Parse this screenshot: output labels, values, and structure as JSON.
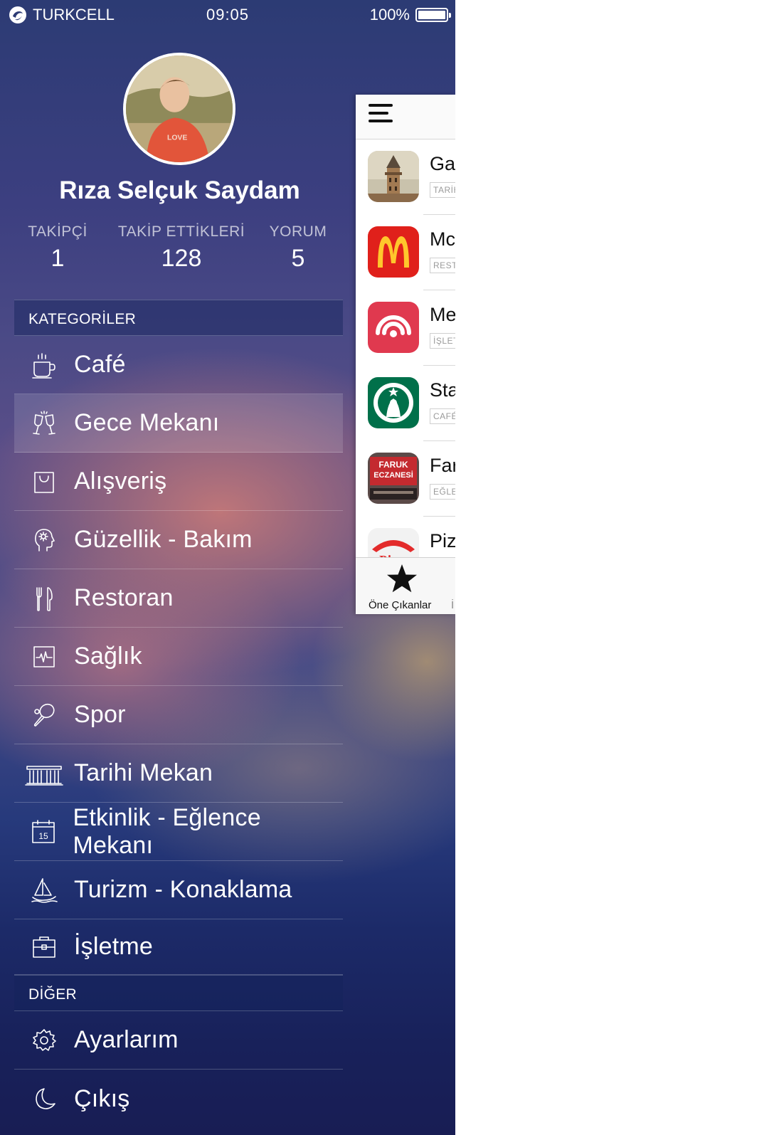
{
  "status_bar": {
    "carrier": "TURKCELL",
    "time": "09:05",
    "battery_text": "100%",
    "battery_level": 1.0
  },
  "profile": {
    "name": "Rıza Selçuk Saydam",
    "stats": [
      {
        "label": "TAKİPÇİ",
        "value": "1"
      },
      {
        "label": "TAKİP ETTİKLERİ",
        "value": "128"
      },
      {
        "label": "YORUM",
        "value": "5"
      }
    ]
  },
  "menu": {
    "categories_header": "KATEGORİLER",
    "categories": [
      {
        "label": "Café",
        "icon": "coffee-cup-icon"
      },
      {
        "label": "Gece Mekanı",
        "icon": "cheers-glasses-icon",
        "active": true
      },
      {
        "label": "Alışveriş",
        "icon": "shopping-bag-icon"
      },
      {
        "label": "Güzellik - Bakım",
        "icon": "beauty-head-icon"
      },
      {
        "label": "Restoran",
        "icon": "fork-knife-icon"
      },
      {
        "label": "Sağlık",
        "icon": "heartbeat-icon"
      },
      {
        "label": "Spor",
        "icon": "racket-icon"
      },
      {
        "label": "Tarihi Mekan",
        "icon": "historic-building-icon"
      },
      {
        "label": "Etkinlik - Eğlence Mekanı",
        "icon": "calendar-icon",
        "calendar_day": "15"
      },
      {
        "label": "Turizm - Konaklama",
        "icon": "sailboat-icon"
      },
      {
        "label": "İşletme",
        "icon": "briefcase-icon"
      }
    ],
    "other_header": "DİĞER",
    "other": [
      {
        "label": "Ayarlarım",
        "icon": "gear-icon"
      },
      {
        "label": "Çıkış",
        "icon": "moon-icon"
      }
    ]
  },
  "feed": {
    "items": [
      {
        "title": "Gal",
        "tag": "TARİH"
      },
      {
        "title": "Mc",
        "tag": "REST"
      },
      {
        "title": "Me",
        "tag": "İŞLET"
      },
      {
        "title": "Sta",
        "tag": "CAFÉ"
      },
      {
        "title": "Far",
        "tag": "EĞLE"
      },
      {
        "title": "Piz",
        "tag": ""
      }
    ],
    "thumb_texts": {
      "faruk_line1": "FARUK",
      "faruk_line2": "ECZANESİ",
      "pizza": "Pizza"
    },
    "tab_bar": {
      "featured_label": "Öne Çıkanlar",
      "next_peek": "İ"
    }
  },
  "colors": {
    "mcdonalds_red": "#e0201b",
    "mcdonalds_yellow": "#ffc72c",
    "starbucks_green": "#00704a",
    "meetup_red": "#e0394f"
  }
}
